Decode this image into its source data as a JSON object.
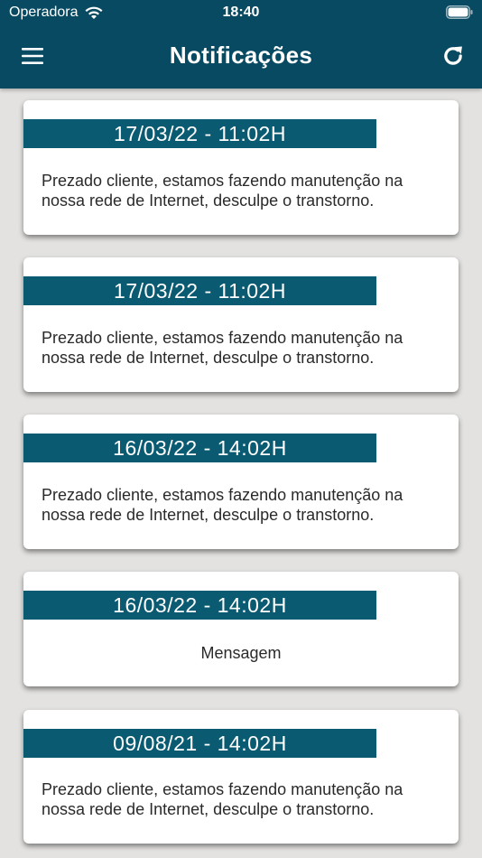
{
  "status": {
    "carrier": "Operadora",
    "time": "18:40"
  },
  "header": {
    "title": "Notificações",
    "menu_icon": "hamburger-menu-icon",
    "refresh_icon": "refresh-icon",
    "background": "#074a61"
  },
  "notifications": [
    {
      "date": "17/03/22 - 11:02H",
      "message": "Prezado cliente, estamos fazendo manutenção na nossa rede de Internet, desculpe o transtorno."
    },
    {
      "date": "17/03/22 - 11:02H",
      "message": "Prezado cliente, estamos fazendo manutenção na nossa rede de Internet, desculpe o transtorno."
    },
    {
      "date": "16/03/22 - 14:02H",
      "message": "Prezado cliente, estamos fazendo manutenção na nossa rede de Internet, desculpe o transtorno."
    },
    {
      "date": "16/03/22 - 14:02H",
      "message": "Mensagem"
    },
    {
      "date": "09/08/21 - 14:02H",
      "message": "Prezado cliente, estamos fazendo manutenção na nossa rede de Internet, desculpe o transtorno."
    }
  ]
}
